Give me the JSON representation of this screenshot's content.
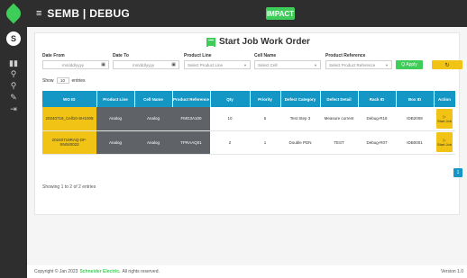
{
  "app": {
    "title": "SEMB | DEBUG",
    "logo_label": "IMPACT",
    "brand_letter": "S"
  },
  "page": {
    "title": "Start Job Work Order"
  },
  "filters": {
    "date_from_label": "Date From",
    "date_from_value": "mm/dd/yyyy",
    "date_to_label": "Date To",
    "date_to_value": "mm/dd/yyyy",
    "product_line_label": "Product Line",
    "product_line_placeholder": "Select Product Line",
    "cell_name_label": "Cell Name",
    "cell_name_placeholder": "Select Cell",
    "product_reference_label": "Product Reference",
    "product_reference_placeholder": "Select Product Reference",
    "apply_label": "Q Apply",
    "reset_label": "↻"
  },
  "list_controls": {
    "show_label": "Show",
    "show_value": "10",
    "entries_label": "entries"
  },
  "table": {
    "headers": [
      "WO ID",
      "Product Line",
      "Cell Name",
      "Product Reference",
      "Qty",
      "Priority",
      "Defect Category",
      "Defect Detail",
      "Rack ID",
      "Box ID",
      "Action"
    ],
    "rows": [
      {
        "wo_id": "20240719_Cell10-SH1008",
        "product_line": "Analog",
        "cell_name": "Analog",
        "product_reference": "FMG3A100",
        "qty": "10",
        "priority": "5",
        "defect_category": "Test Step 3",
        "defect_detail": "Measure current",
        "rack_id": "Debug-R18",
        "box_id": "IDB2008",
        "action": "Start Job"
      },
      {
        "wo_id": "20240719RAQ-DF-SN040022",
        "product_line": "Analog",
        "cell_name": "Analog",
        "product_reference": "TPRAAQ01",
        "qty": "2",
        "priority": "1",
        "defect_category": "Double PDN",
        "defect_detail": "TEST",
        "rack_id": "Debug-R07",
        "box_id": "IDB0001",
        "action": "Start Job"
      }
    ]
  },
  "pagination": {
    "info": "Showing 1 to 2 of 2 entries",
    "current_page": "1"
  },
  "footer": {
    "copyright_prefix": "Copyright © Jan 2023",
    "brand": "Schneider Electric.",
    "rights": "All rights reserved.",
    "version": "Version 1.0"
  },
  "colors": {
    "accent_green": "#3dcd58",
    "header_blue": "#1497c4",
    "highlight_yellow": "#f0c314",
    "dark_gray": "#5f6368"
  }
}
